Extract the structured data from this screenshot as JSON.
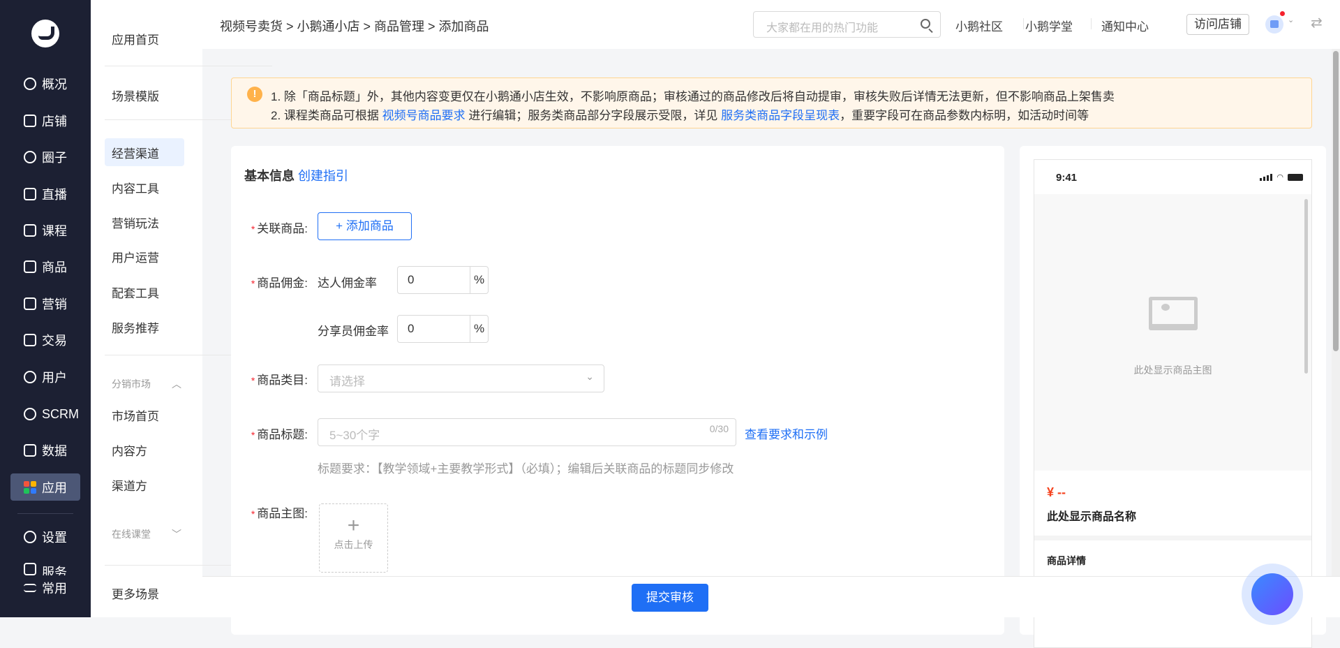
{
  "nav": {
    "items": [
      {
        "label": "概况"
      },
      {
        "label": "店铺"
      },
      {
        "label": "圈子"
      },
      {
        "label": "直播"
      },
      {
        "label": "课程"
      },
      {
        "label": "商品"
      },
      {
        "label": "营销"
      },
      {
        "label": "交易"
      },
      {
        "label": "用户"
      },
      {
        "label": "SCRM"
      },
      {
        "label": "数据"
      },
      {
        "label": "应用"
      }
    ],
    "settings": "设置",
    "service": "服务",
    "common": "常用"
  },
  "sub": {
    "home": "应用首页",
    "templates": "场景模版",
    "items": [
      "经营渠道",
      "内容工具",
      "营销玩法",
      "用户运营",
      "配套工具",
      "服务推荐"
    ],
    "group1": "分销市场",
    "group1_items": [
      "市场首页",
      "内容方",
      "渠道方"
    ],
    "group2": "在线课堂",
    "more": "更多场景"
  },
  "header": {
    "breadcrumb": "视频号卖货 > 小鹅通小店 > 商品管理 > 添加商品",
    "search_placeholder": "大家都在用的热门功能",
    "links": [
      "小鹅社区",
      "小鹅学堂",
      "通知中心"
    ],
    "visit_store": "访问店铺"
  },
  "notice": {
    "line1": "1. 除「商品标题」外，其他内容变更仅在小鹅通小店生效，不影响原商品；审核通过的商品修改后将自动提审，审核失败后详情无法更新，但不影响商品上架售卖",
    "line2_a": "2. 课程类商品可根据 ",
    "link1": "视频号商品要求",
    "line2_b": " 进行编辑；服务类商品部分字段展示受限，详见 ",
    "link2": "服务类商品字段呈现表",
    "line2_c": "，重要字段可在商品参数内标明，如活动时间等"
  },
  "form": {
    "section_title": "基本信息",
    "guide_link": "创建指引",
    "req": "*",
    "related_label": "关联商品:",
    "add_product": "+ 添加商品",
    "commission_label": "商品佣金:",
    "talent_rate_label": "达人佣金率",
    "talent_rate": "0",
    "sharer_rate_label": "分享员佣金率",
    "sharer_rate": "0",
    "percent": "%",
    "category_label": "商品类目:",
    "category_placeholder": "请选择",
    "title_label": "商品标题:",
    "title_placeholder": "5~30个字",
    "title_count": "0/30",
    "title_example_link": "查看要求和示例",
    "title_hint": "标题要求：【教学领域+主要教学形式】（必填）；编辑后关联商品的标题同步修改",
    "image_label": "商品主图:",
    "upload": "点击上传"
  },
  "preview": {
    "time": "9:41",
    "image_placeholder": "此处显示商品主图",
    "price": "¥ --",
    "name": "此处显示商品名称",
    "detail": "商品详情"
  },
  "footer": {
    "submit": "提交审核"
  },
  "colors": {
    "primary": "#1f6ff5",
    "sidebar": "#1c2033",
    "warning_bg": "#fff6ea"
  }
}
